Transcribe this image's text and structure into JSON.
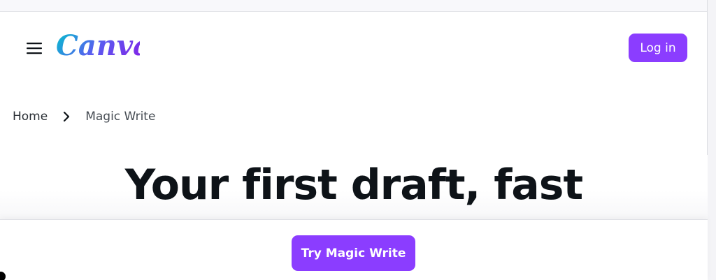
{
  "header": {
    "logo_text": "Canva",
    "login_label": "Log in"
  },
  "breadcrumb": {
    "home": "Home",
    "current": "Magic Write"
  },
  "hero": {
    "title": "Your first draft, fast"
  },
  "cta": {
    "label": "Try Magic Write"
  },
  "icons": {
    "menu": "hamburger-menu-icon",
    "separator": "chevron-right-icon"
  },
  "colors": {
    "brand_purple": "#8b3dff",
    "logo_gradient_start": "#00c4cc",
    "logo_gradient_mid": "#5a5bf0",
    "logo_gradient_end": "#7d2ae8",
    "text_dark": "#0e1318"
  }
}
